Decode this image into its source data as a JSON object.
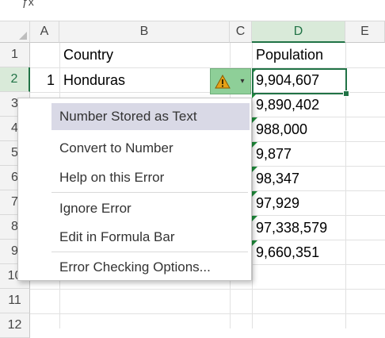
{
  "top_fragment": "ƒx",
  "columns": [
    "A",
    "B",
    "C",
    "D",
    "E"
  ],
  "rows": [
    "1",
    "2",
    "3",
    "4",
    "5",
    "6",
    "7",
    "8",
    "9",
    "10",
    "11",
    "12"
  ],
  "cells": {
    "B1": "Country",
    "D1": "Population",
    "A2": "1",
    "B2": "Honduras",
    "D2": "9,904,607",
    "D3": "9,890,402",
    "D4": "988,000",
    "D5": "9,877",
    "D6": "98,347",
    "D7": "97,929",
    "D8": "97,338,579",
    "D9": "9,660,351"
  },
  "error_menu": {
    "items": [
      {
        "label": "Number Stored as Text",
        "highlighted": true
      },
      {
        "label": "Convert to Number"
      },
      {
        "label": "Help on this Error"
      },
      {
        "label": "Ignore Error"
      },
      {
        "label": "Edit in Formula Bar"
      },
      {
        "label": "Error Checking Options..."
      }
    ]
  },
  "colors": {
    "accent": "#217346",
    "error_indicator": "#1e8c3a",
    "warning": "#e6a117",
    "menu_highlight": "#d9d9e6"
  },
  "icons": {
    "warning": "warning-triangle-icon",
    "dropdown": "chevron-down-icon"
  }
}
